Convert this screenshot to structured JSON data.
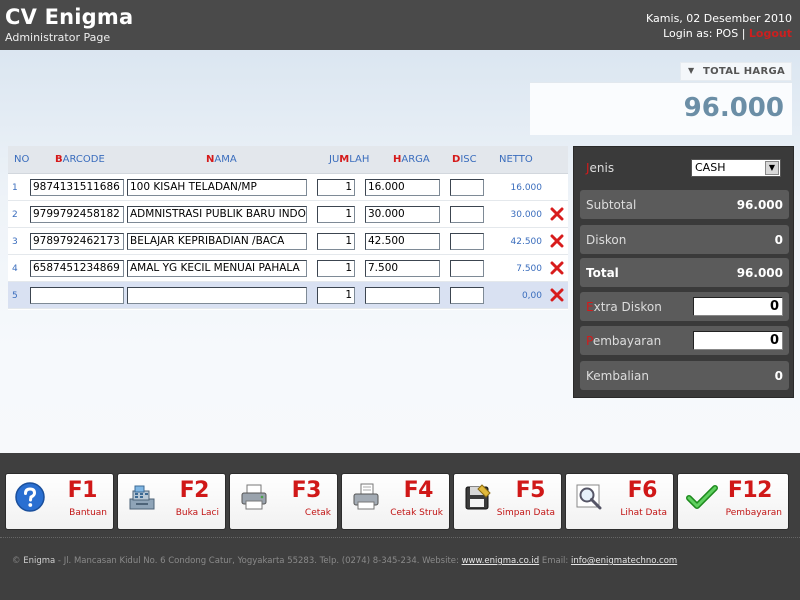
{
  "header": {
    "title": "CV Enigma",
    "subtitle": "Administrator Page",
    "date": "Kamis, 02 Desember 2010",
    "login_prefix": "Login as: POS |",
    "logout": "Logout"
  },
  "total": {
    "label": "TOTAL HARGA",
    "value": "96.000"
  },
  "table": {
    "columns": {
      "no": "NO",
      "barcode_key": "B",
      "barcode_rest": "ARCODE",
      "nama_key": "N",
      "nama_rest": "AMA",
      "jumlah_pre": "JU",
      "jumlah_key": "M",
      "jumlah_rest": "LAH",
      "harga_key": "H",
      "harga_rest": "ARGA",
      "disc_key": "D",
      "disc_rest": "ISC",
      "netto": "NETTO"
    },
    "rows": [
      {
        "no": "1",
        "barcode": "9874131511686",
        "nama": "100 KISAH TELADAN/MP",
        "jumlah": "1",
        "harga": "16.000",
        "disc": "",
        "netto": "16.000"
      },
      {
        "no": "2",
        "barcode": "9799792458182",
        "nama": "ADMNISTRASI PUBLIK BARU INDONESIA",
        "jumlah": "1",
        "harga": "30.000",
        "disc": "",
        "netto": "30.000"
      },
      {
        "no": "3",
        "barcode": "9789792462173",
        "nama": "BELAJAR KEPRIBADIAN /BACA",
        "jumlah": "1",
        "harga": "42.500",
        "disc": "",
        "netto": "42.500"
      },
      {
        "no": "4",
        "barcode": "6587451234869",
        "nama": "AMAL YG KECIL MENUAI PAHALA",
        "jumlah": "1",
        "harga": "7.500",
        "disc": "",
        "netto": "7.500"
      },
      {
        "no": "5",
        "barcode": "",
        "nama": "",
        "jumlah": "1",
        "harga": "",
        "disc": "",
        "netto": "0,00"
      }
    ]
  },
  "summary": {
    "jenis_key": "J",
    "jenis_rest": "enis",
    "jenis_value": "CASH",
    "subtotal_label": "Subtotal",
    "subtotal_value": "96.000",
    "diskon_label": "Diskon",
    "diskon_value": "0",
    "total_label": "Total",
    "total_value": "96.000",
    "extra_key": "E",
    "extra_rest": "xtra Diskon",
    "extra_value": "0",
    "bayar_key": "P",
    "bayar_rest": "embayaran",
    "bayar_value": "0",
    "kembalian_label": "Kembalian",
    "kembalian_value": "0"
  },
  "fkeys": [
    {
      "code": "F1",
      "label": "Bantuan",
      "icon": "help-icon"
    },
    {
      "code": "F2",
      "label": "Buka Laci",
      "icon": "cash-register-icon"
    },
    {
      "code": "F3",
      "label": "Cetak",
      "icon": "printer-icon"
    },
    {
      "code": "F4",
      "label": "Cetak Struk",
      "icon": "receipt-printer-icon"
    },
    {
      "code": "F5",
      "label": "Simpan Data",
      "icon": "save-data-icon"
    },
    {
      "code": "F6",
      "label": "Lihat Data",
      "icon": "view-data-icon"
    },
    {
      "code": "F12",
      "label": "Pembayaran",
      "icon": "checkmark-icon"
    }
  ],
  "footer": {
    "brand": "Enigma",
    "address": "- Jl. Mancasan Kidul No. 6 Condong Catur, Yogyakarta 55283. Telp. (0274) 8-345-234. Website:",
    "website": "www.enigma.co.id",
    "email_label": "Email:",
    "email": "info@enigmatechno.com"
  }
}
